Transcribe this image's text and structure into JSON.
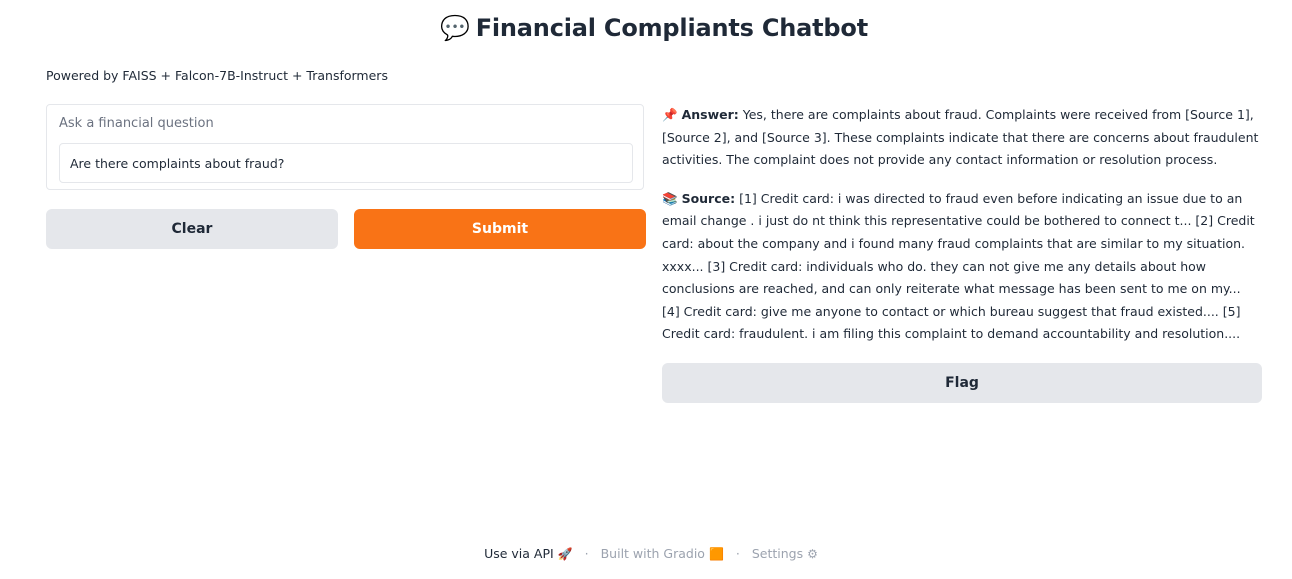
{
  "header": {
    "icon": "speech-balloon-icon",
    "title": "Financial Compliants Chatbot",
    "subtitle": "Powered by FAISS + Falcon-7B-Instruct + Transformers"
  },
  "query": {
    "label": "Ask a financial question",
    "value": "Are there complaints about fraud?"
  },
  "buttons": {
    "clear": "Clear",
    "submit": "Submit",
    "flag": "Flag"
  },
  "output": {
    "answer_icon": "pushpin-icon",
    "answer_label": "Answer:",
    "answer_text": " Yes, there are complaints about fraud. Complaints were received from [Source 1], [Source 2], and [Source 3]. These complaints indicate that there are concerns about fraudulent activities. The complaint does not provide any contact information or resolution process.",
    "source_icon": "books-icon",
    "source_label": "Source:",
    "source_text": " [1] Credit card: i was directed to fraud even before indicating an issue due to an email change . i just do nt think this representative could be bothered to connect t... [2] Credit card: about the company and i found many fraud complaints that are similar to my situation. xxxx... [3] Credit card: individuals who do. they can not give me any details about how conclusions are reached, and can only reiterate what message has been sent to me on my... [4] Credit card: give me anyone to contact or which bureau suggest that fraud existed.... [5] Credit card: fraudulent. i am filing this complaint to demand accountability and resolution...."
  },
  "footer": {
    "api": "Use via API",
    "built": "Built with Gradio",
    "settings": "Settings"
  },
  "colors": {
    "accent": "#f97316",
    "secondary_button": "#e5e7eb"
  }
}
